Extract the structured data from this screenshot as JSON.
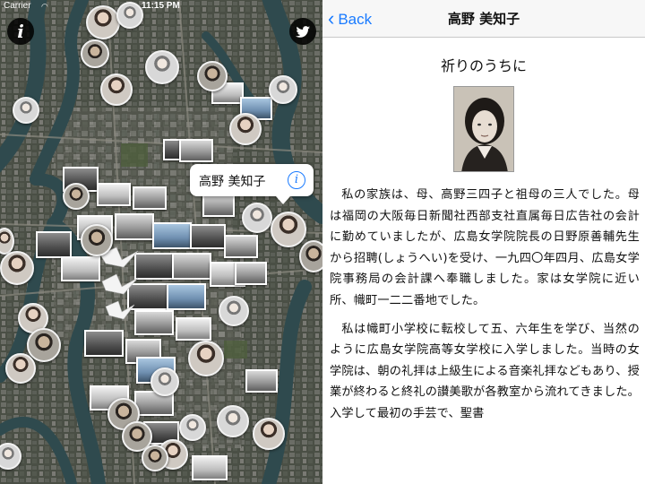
{
  "status_bar": {
    "carrier": "Carrier",
    "time": "11:15 PM"
  },
  "map": {
    "info_button_label": "i",
    "callout": {
      "title": "高野 美知子",
      "info_label": "i"
    },
    "icons": {
      "info": "info-icon",
      "twitter": "twitter-icon",
      "wifi": "wifi-icon",
      "detail": "info-circle-icon",
      "crane": "paper-crane-icon"
    }
  },
  "detail": {
    "back_label": "Back",
    "nav_title": "高野 美知子",
    "article_title": "祈りのうちに",
    "paragraphs": [
      "私の家族は、母、高野三四子と祖母の三人でした。母は福岡の大阪毎日新聞社西部支社直属毎日広告社の会計に勤めていましたが、広島女学院院長の日野原善輔先生から招聘(しょうへい)を受け、一九四〇年四月、広島女学院事務局の会計課へ奉職しました。家は女学院に近い所、幟町一二二番地でした。",
      "私は幟町小学校に転校して五、六年生を学び、当然のように広島女学院高等女学校に入学しました。当時の女学院は、朝の礼拝は上級生による音楽礼拝などもあり、授業が終わると終礼の讃美歌が各教室から流れてきました。入学して最初の手芸で、聖書"
    ]
  },
  "colors": {
    "ios_blue": "#1a7bff",
    "navbar_bg": "#f7f7f7"
  }
}
